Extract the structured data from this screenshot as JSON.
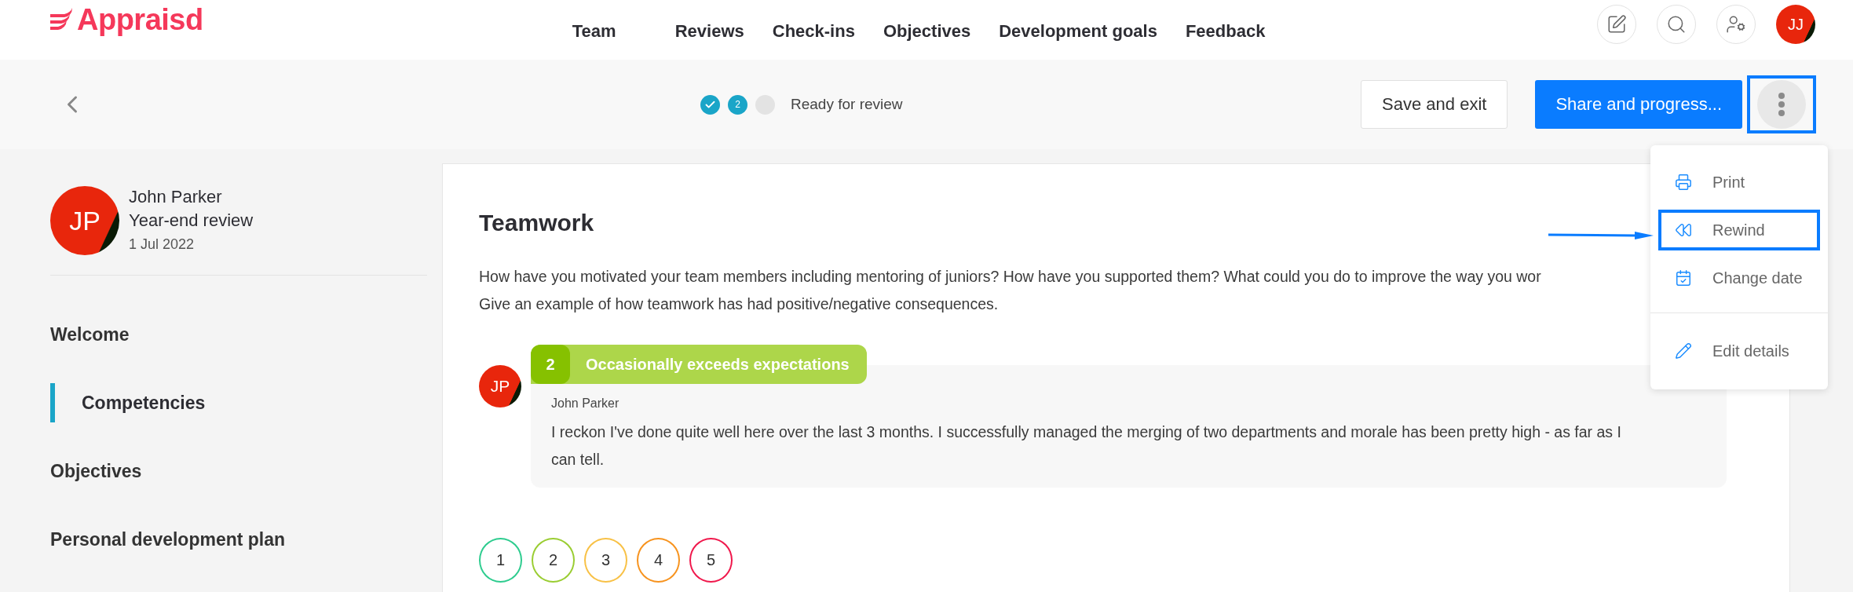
{
  "brand": {
    "name": "Appraisd"
  },
  "nav": [
    {
      "label": "Team"
    },
    {
      "label": "Reviews"
    },
    {
      "label": "Check-ins"
    },
    {
      "label": "Objectives"
    },
    {
      "label": "Development goals"
    },
    {
      "label": "Feedback"
    }
  ],
  "header_actions": [
    {
      "kind": "edit"
    },
    {
      "kind": "search"
    },
    {
      "kind": "user-settings"
    },
    {
      "kind": "avatar",
      "initials": "JJ"
    }
  ],
  "progress": {
    "steps": [
      {
        "completed": true,
        "current": false
      },
      {
        "completed": false,
        "current": true,
        "label": "2"
      },
      {
        "completed": false,
        "current": false
      }
    ],
    "label": "Ready for review"
  },
  "actions": {
    "save": "Save and exit",
    "share": "Share and progress...",
    "more_highlighted": true
  },
  "menu": {
    "items": [
      {
        "kind": "print",
        "label": "Print",
        "highlighted": false
      },
      {
        "kind": "rewind",
        "label": "Rewind",
        "highlighted": true
      },
      {
        "kind": "date",
        "label": "Change date",
        "highlighted": false
      },
      {
        "kind": "edit",
        "label": "Edit details",
        "highlighted": false
      }
    ]
  },
  "profile": {
    "initials": "JP",
    "name": "John Parker",
    "review": "Year-end review",
    "date": "1 Jul 2022"
  },
  "sections": [
    {
      "label": "Welcome",
      "selected": false
    },
    {
      "label": "Competencies",
      "selected": true
    },
    {
      "label": "Objectives",
      "selected": false
    },
    {
      "label": "Personal development plan",
      "selected": false
    }
  ],
  "question": {
    "title": "Teamwork",
    "lines": [
      "How have you motivated your team members including mentoring of juniors? How have you supported them? What could you do to improve the way you wor",
      "Give an example of how teamwork has had positive/negative consequences."
    ]
  },
  "answer": {
    "initials": "JP",
    "rating": "2",
    "rating_label": "Occasionally exceeds expectations",
    "author": "John Parker",
    "text": "I reckon I've done quite well here over the last 3 months. I successfully managed the merging of two departments and morale has been pretty high - as far as I can tell."
  },
  "scale": [
    {
      "label": "1",
      "color": "#2ecc8f"
    },
    {
      "label": "2",
      "color": "#9acd32"
    },
    {
      "label": "3",
      "color": "#f8c146"
    },
    {
      "label": "4",
      "color": "#f7931e"
    },
    {
      "label": "5",
      "color": "#f0184c"
    }
  ]
}
